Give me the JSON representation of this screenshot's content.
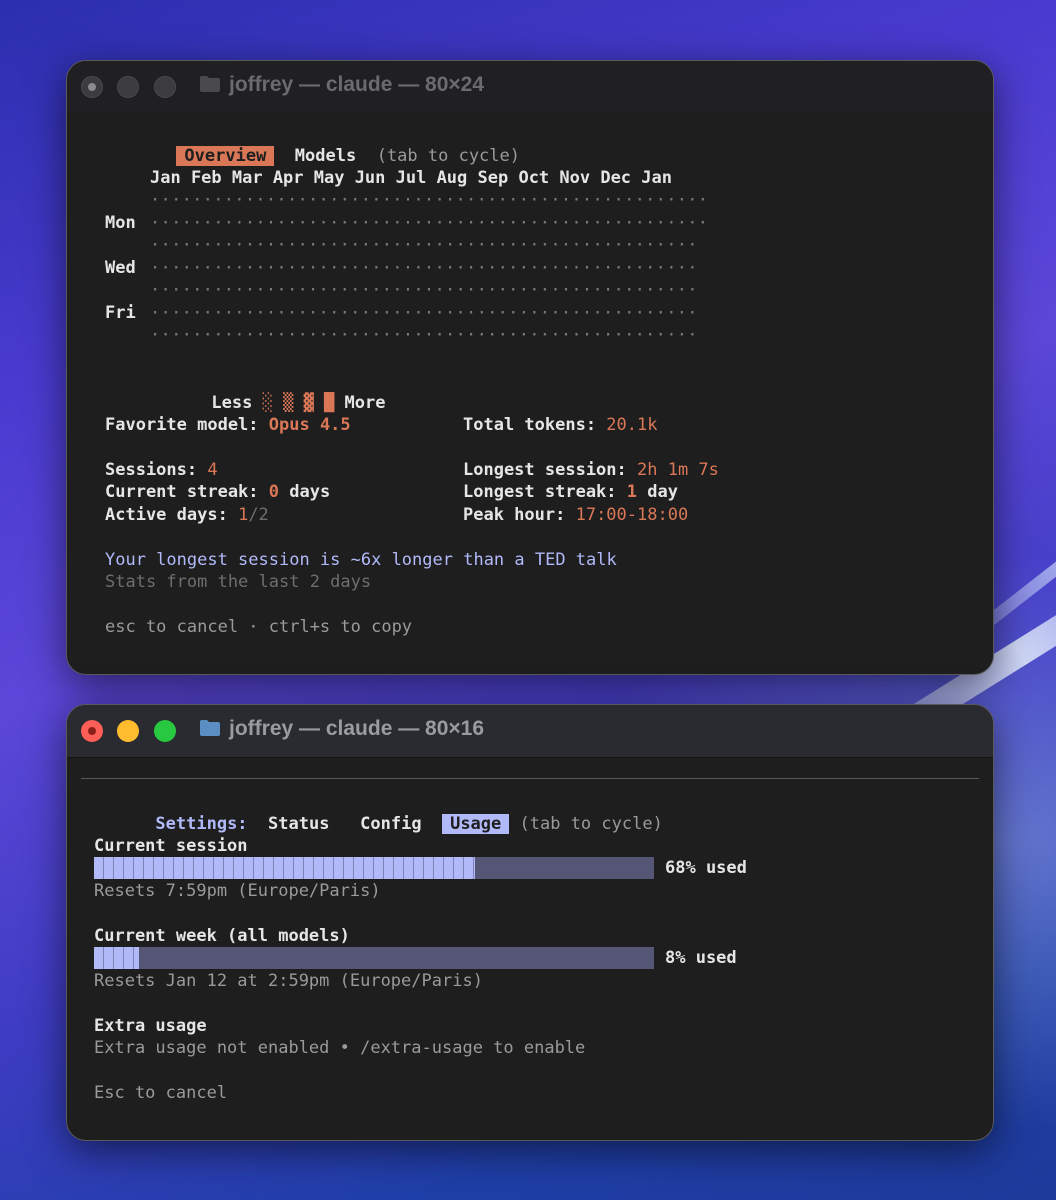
{
  "window1": {
    "title": "joffrey — claude — 80×24",
    "tabs": {
      "overview": "Overview",
      "models": "Models",
      "hint": "(tab to cycle)"
    },
    "months": "Jan Feb Mar Apr May Jun Jul Aug Sep Oct Nov Dec Jan",
    "day_labels": {
      "mon": "Mon",
      "wed": "Wed",
      "fri": "Fri"
    },
    "heatmap_rows": [
      "·····················································",
      "·····················································",
      "····················································",
      "····················································",
      "····················································",
      "····················································",
      "····················································"
    ],
    "legend": {
      "less": "Less",
      "shades": "░ ▒ ▓ █",
      "more": "More"
    },
    "stats": {
      "favorite_model_label": "Favorite model: ",
      "favorite_model_value": "Opus 4.5",
      "total_tokens_label": "Total tokens: ",
      "total_tokens_value": "20.1k",
      "sessions_label": "Sessions: ",
      "sessions_value": "4",
      "longest_session_label": "Longest session: ",
      "longest_session_value": "2h 1m 7s",
      "current_streak_label": "Current streak: ",
      "current_streak_value": "0",
      "current_streak_unit": " days",
      "longest_streak_label": "Longest streak: ",
      "longest_streak_value": "1",
      "longest_streak_unit": " day",
      "active_days_label": "Active days: ",
      "active_days_value": "1",
      "active_days_total": "/2",
      "peak_hour_label": "Peak hour: ",
      "peak_hour_value": "17:00-18:00"
    },
    "fun_fact": "Your longest session is ~6x longer than a TED talk",
    "stats_range": "Stats from the last 2 days",
    "footer": "esc to cancel · ctrl+s to copy"
  },
  "window2": {
    "title": "joffrey — claude — 80×16",
    "settings_label": "Settings:",
    "tabs": {
      "status": "Status",
      "config": "Config",
      "usage": "Usage",
      "hint": "(tab to cycle)"
    },
    "current_session": {
      "title": "Current session",
      "percent": 68,
      "used_label": "68% used",
      "resets": "Resets 7:59pm (Europe/Paris)"
    },
    "current_week": {
      "title": "Current week (all models)",
      "percent": 8,
      "used_label": "8% used",
      "resets": "Resets Jan 12 at 2:59pm (Europe/Paris)"
    },
    "extra_usage": {
      "title": "Extra usage",
      "status": "Extra usage not enabled • /extra-usage to enable"
    },
    "footer": "Esc to cancel"
  },
  "colors": {
    "accent_orange": "#d97757",
    "accent_lavender": "#b1b9f9",
    "bar_track": "#555575",
    "terminal_bg": "#1e1e1e"
  }
}
